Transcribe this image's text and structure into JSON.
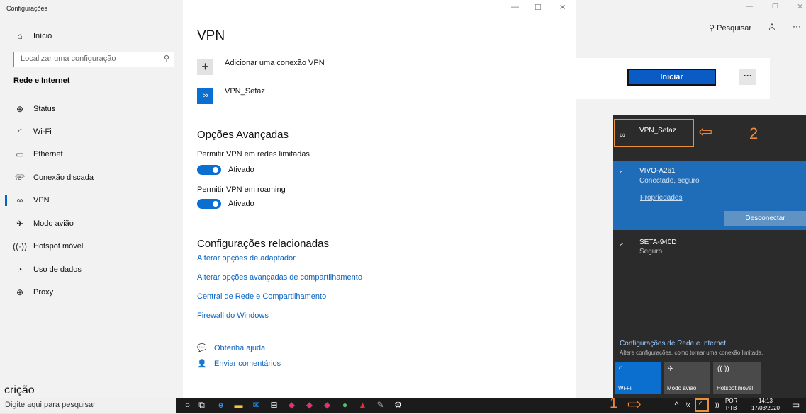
{
  "window": {
    "title": "Configurações"
  },
  "sidebar": {
    "home": "Início",
    "search_placeholder": "Localizar uma configuração",
    "section": "Rede e Internet",
    "items": [
      {
        "label": "Status",
        "icon": "globe-icon"
      },
      {
        "label": "Wi-Fi",
        "icon": "wifi-icon"
      },
      {
        "label": "Ethernet",
        "icon": "ethernet-icon"
      },
      {
        "label": "Conexão discada",
        "icon": "phone-icon"
      },
      {
        "label": "VPN",
        "icon": "vpn-icon"
      },
      {
        "label": "Modo avião",
        "icon": "airplane-icon"
      },
      {
        "label": "Hotspot móvel",
        "icon": "hotspot-icon"
      },
      {
        "label": "Uso de dados",
        "icon": "data-usage-icon"
      },
      {
        "label": "Proxy",
        "icon": "proxy-icon"
      }
    ]
  },
  "main": {
    "title": "VPN",
    "add_vpn": "Adicionar uma conexão VPN",
    "vpn_name": "VPN_Sefaz",
    "advanced_title": "Opções Avançadas",
    "opt1_label": "Permitir VPN em redes limitadas",
    "opt1_state": "Ativado",
    "opt2_label": "Permitir VPN em roaming",
    "opt2_state": "Ativado",
    "related_title": "Configurações relacionadas",
    "links": [
      "Alterar opções de adaptador",
      "Alterar opções avançadas de compartilhamento",
      "Central de Rede e Compartilhamento",
      "Firewall do Windows"
    ],
    "help": "Obtenha ajuda",
    "feedback": "Enviar comentários"
  },
  "background": {
    "search": "Pesquisar",
    "button": "Iniciar",
    "more": "···",
    "fragment": "crição"
  },
  "flyout": {
    "vpn": "VPN_Sefaz",
    "wifi1_name": "VIVO-A261",
    "wifi1_status": "Conectado, seguro",
    "properties": "Propriedades",
    "disconnect": "Desconectar",
    "wifi2_name": "SETA-940D",
    "wifi2_status": "Seguro",
    "settings_link": "Configurações de Rede e Internet",
    "settings_sub": "Altere configurações, como tornar uma conexão limitada.",
    "tiles": [
      "Wi-Fi",
      "Modo avião",
      "Hotspot móvel"
    ]
  },
  "annotations": {
    "label1": "1",
    "label2": "2",
    "color": "#f0883a"
  },
  "taskbar": {
    "search_placeholder": "Digite aqui para pesquisar",
    "lang1": "POR",
    "lang2": "PTB",
    "time": "14:13",
    "date": "17/03/2020"
  }
}
